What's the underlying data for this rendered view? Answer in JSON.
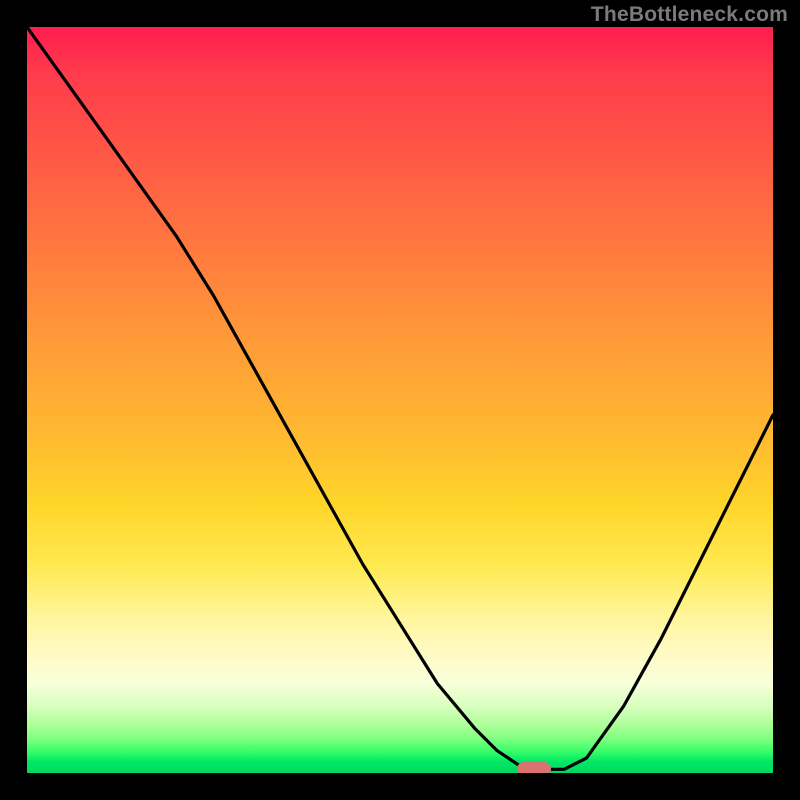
{
  "watermark": "TheBottleneck.com",
  "colors": {
    "curve_stroke": "#000000",
    "marker_fill": "#d9736f",
    "frame_bg": "#000000"
  },
  "chart_data": {
    "type": "line",
    "title": "",
    "xlabel": "",
    "ylabel": "",
    "xlim": [
      0,
      100
    ],
    "ylim": [
      0,
      100
    ],
    "grid": false,
    "legend": false,
    "series": [
      {
        "name": "bottleneck-curve",
        "x": [
          0,
          5,
          10,
          15,
          20,
          25,
          30,
          35,
          40,
          45,
          50,
          55,
          60,
          63,
          66,
          68,
          70,
          72,
          75,
          80,
          85,
          90,
          95,
          100
        ],
        "values": [
          100,
          93,
          86,
          79,
          72,
          64,
          55,
          46,
          37,
          28,
          20,
          12,
          6,
          3,
          1,
          0.5,
          0.5,
          0.5,
          2,
          9,
          18,
          28,
          38,
          48
        ]
      }
    ],
    "annotations": [
      {
        "name": "optimal-marker",
        "x": 68,
        "y": 0.5,
        "shape": "pill"
      }
    ],
    "background_gradient_meaning": "red=high bottleneck, green=low bottleneck"
  }
}
